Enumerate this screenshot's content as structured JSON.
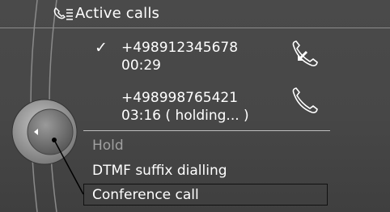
{
  "header": {
    "title": "Active calls",
    "icon": "phone-list-icon"
  },
  "calls": [
    {
      "number": "+498912345678",
      "time": "00:29",
      "status": "",
      "active": true,
      "icon": "incoming-call-icon"
    },
    {
      "number": "+498998765421",
      "time": "03:16",
      "status": "( holding... )",
      "active": false,
      "icon": "handset-icon"
    }
  ],
  "menu": [
    {
      "label": "Hold",
      "enabled": false
    },
    {
      "label": "DTMF suffix dialling",
      "enabled": true
    },
    {
      "label": "Conference call",
      "enabled": true,
      "selected": true
    }
  ],
  "controller": {
    "icon": "idrive-controller-icon"
  },
  "colors": {
    "background": "#474747",
    "text": "#ffffff",
    "disabled": "#a0a0a0"
  }
}
